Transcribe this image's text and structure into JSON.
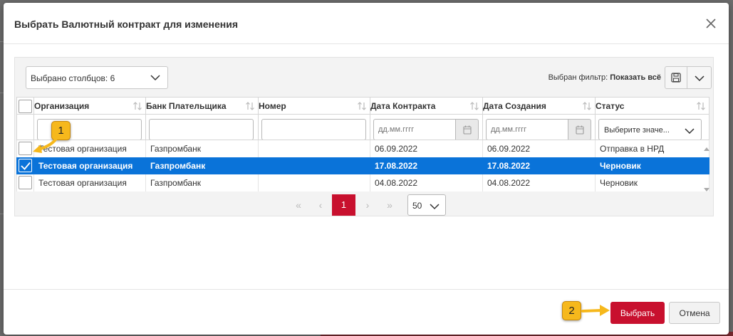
{
  "dialog": {
    "title": "Выбрать Валютный контракт для изменения"
  },
  "toolbar": {
    "columns_selected": "Выбрано столбцов: 6",
    "filter_label": "Выбран фильтр:",
    "filter_value": "Показать всё",
    "save_filter_icon": "save-icon",
    "filter_menu_icon": "chevron-down-icon"
  },
  "grid": {
    "columns": [
      "Организация",
      "Банк Плательщика",
      "Номер",
      "Дата Контракта",
      "Дата Создания",
      "Статус"
    ],
    "filters": {
      "date_placeholder": "дд.мм.гггг",
      "status_placeholder": "Выберите значе..."
    },
    "rows": [
      {
        "selected": false,
        "org": "Тестовая организация",
        "bank": "Газпромбанк",
        "number": "",
        "contract_date": "06.09.2022",
        "created_date": "06.09.2022",
        "status": "Отправка в НРД"
      },
      {
        "selected": true,
        "org": "Тестовая организация",
        "bank": "Газпромбанк",
        "number": "",
        "contract_date": "17.08.2022",
        "created_date": "17.08.2022",
        "status": "Черновик"
      },
      {
        "selected": false,
        "org": "Тестовая организация",
        "bank": "Газпромбанк",
        "number": "",
        "contract_date": "04.08.2022",
        "created_date": "04.08.2022",
        "status": "Черновик"
      }
    ]
  },
  "pager": {
    "first": "«",
    "prev": "‹",
    "current_page": "1",
    "next": "›",
    "last": "»",
    "page_size": "50"
  },
  "footer": {
    "select_label": "Выбрать",
    "cancel_label": "Отмена"
  },
  "callouts": {
    "step1": "1",
    "step2": "2"
  },
  "colors": {
    "accent": "#c8102e",
    "selection": "#0a73d9",
    "callout": "#f6b81c"
  }
}
